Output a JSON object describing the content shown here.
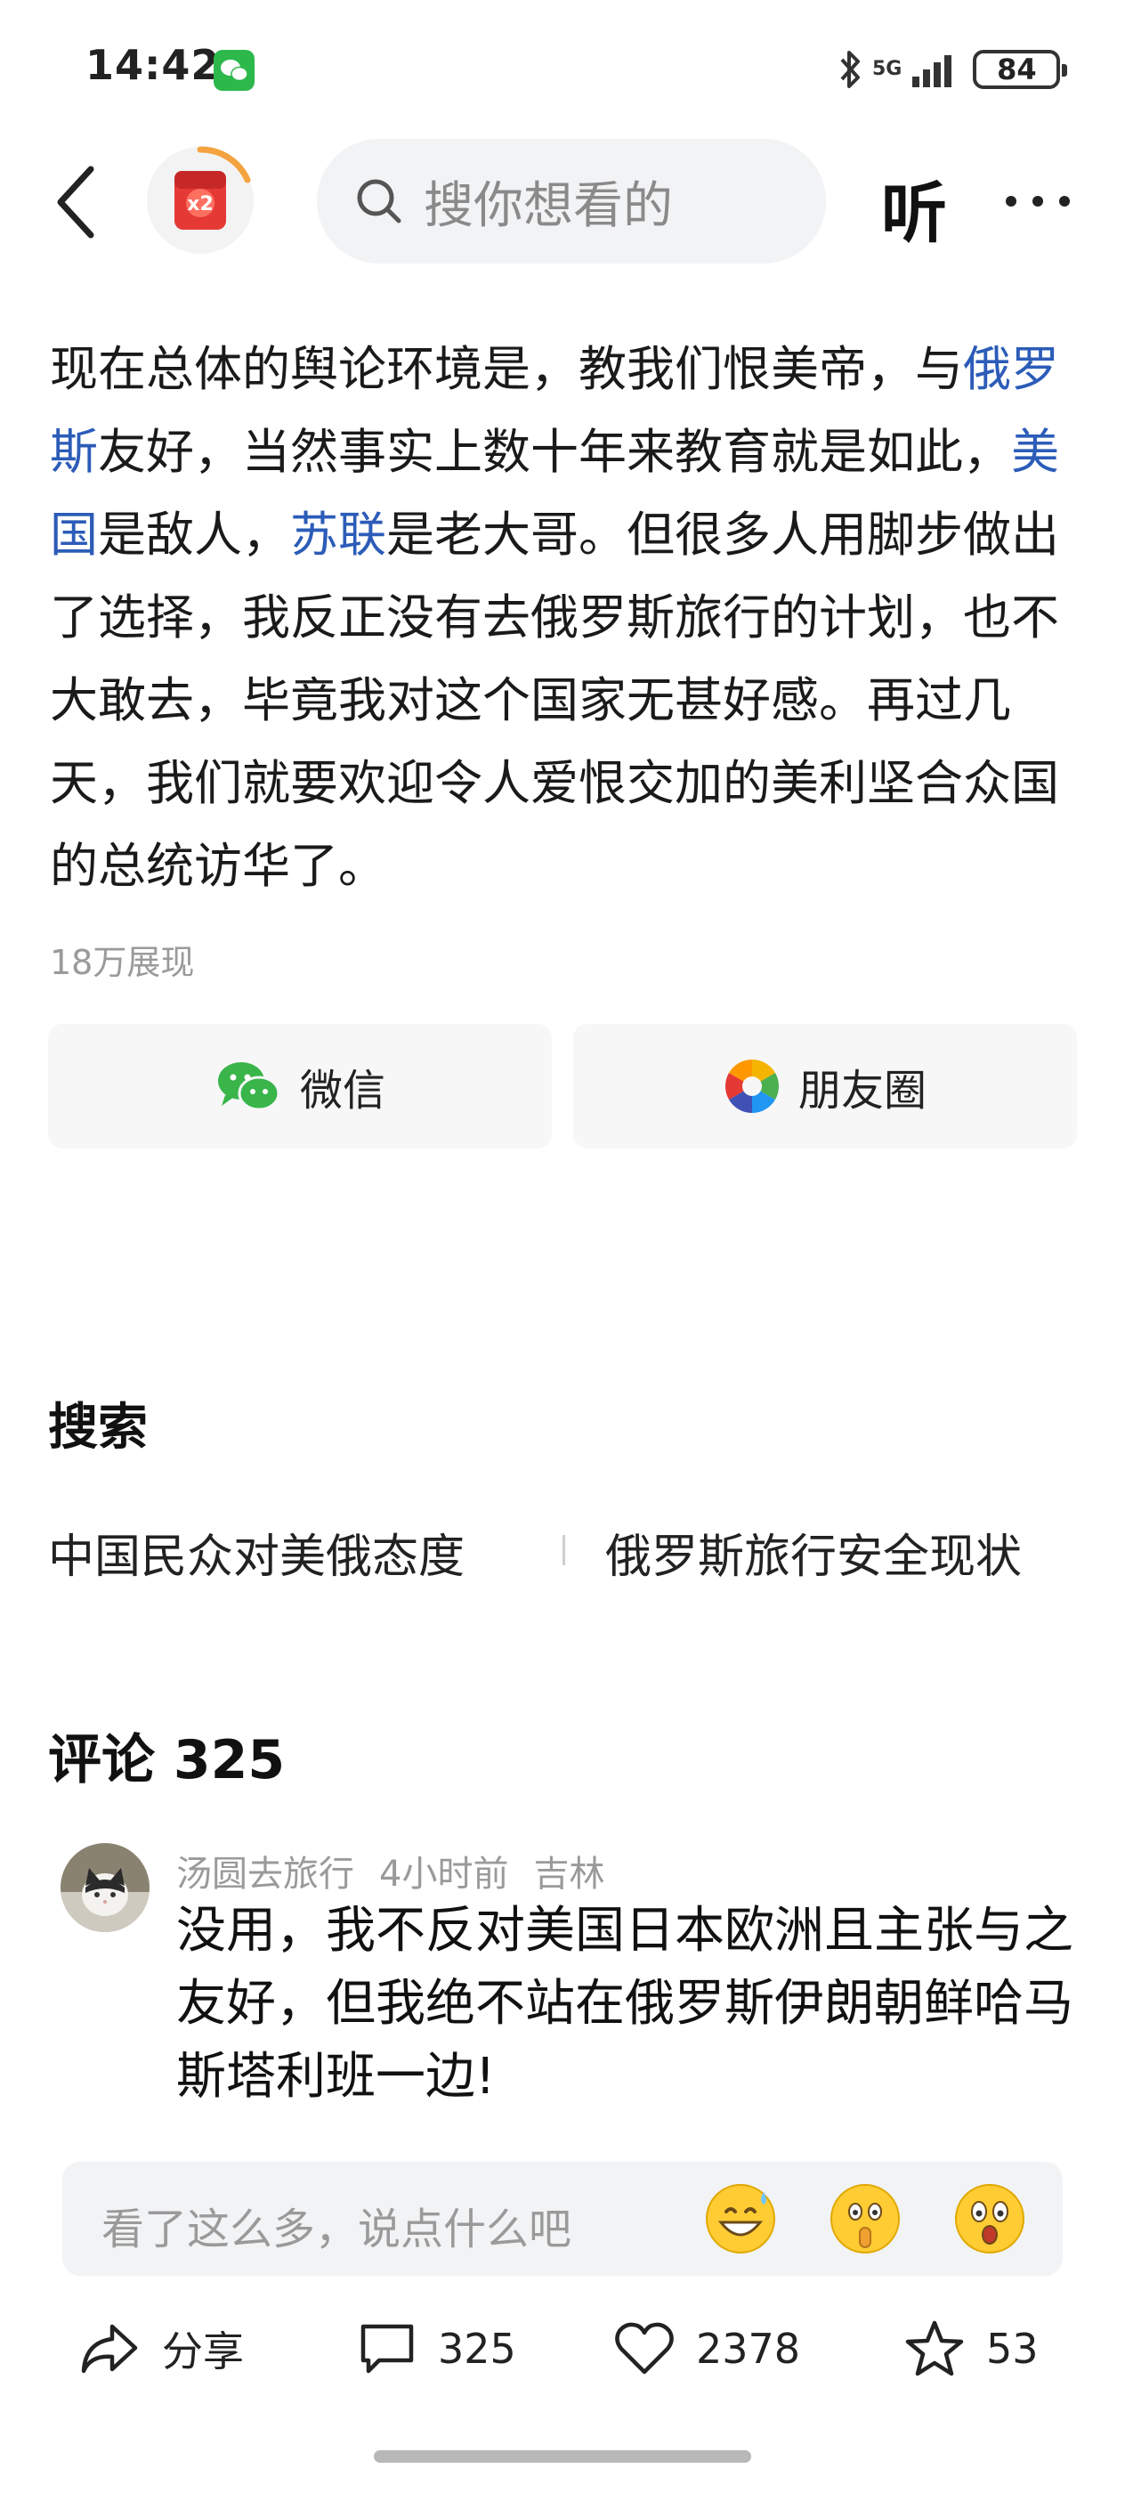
{
  "status_bar": {
    "time": "14:42",
    "network": "5G",
    "battery": "84"
  },
  "nav": {
    "search_placeholder": "搜你想看的",
    "listen_label": "听",
    "badge_label": "x2"
  },
  "article": {
    "p1": "现在总体的舆论环境是，教我们恨美帝，与",
    "link1": "俄罗斯",
    "p2": "友好，当然事实上数十年来教育就是如此，",
    "link2": "美国",
    "p3": "是敌人，",
    "link3": "苏联",
    "p4": "是老大哥。但很多人用脚步做出了选择，我反正没有去俄罗斯旅行的计划，也不大敢去，毕竟我对这个国家无甚好感。再过几天，我们就要欢迎令人爱恨交加的美利坚合众国的总统访华了。",
    "views": "18万展现"
  },
  "share": {
    "wechat": "微信",
    "moments": "朋友圈"
  },
  "search_section": {
    "heading": "搜索",
    "items": [
      "中国民众对美俄态度",
      "俄罗斯旅行安全现状"
    ]
  },
  "comments": {
    "heading": "评论 325",
    "items": [
      {
        "user": "汤圆去旅行",
        "time": "4小时前",
        "location": "吉林",
        "text": "没用，我不反对美国日本欧洲且主张与之友好，但我绝不站在俄罗斯伊朗朝鲜哈马斯塔利班一边!"
      }
    ]
  },
  "input_bar": {
    "placeholder": "看了这么多，说点什么吧"
  },
  "actions": {
    "share": "分享",
    "comments": "325",
    "likes": "2378",
    "favorites": "53"
  },
  "colors": {
    "link": "#2c5cb8",
    "wechat_green": "#2db84b",
    "badge_red": "#e53935"
  },
  "icons": [
    "back-arrow-icon",
    "search-icon",
    "more-icon",
    "wechat-icon",
    "moments-icon",
    "share-icon",
    "comment-icon",
    "heart-icon",
    "star-icon"
  ]
}
